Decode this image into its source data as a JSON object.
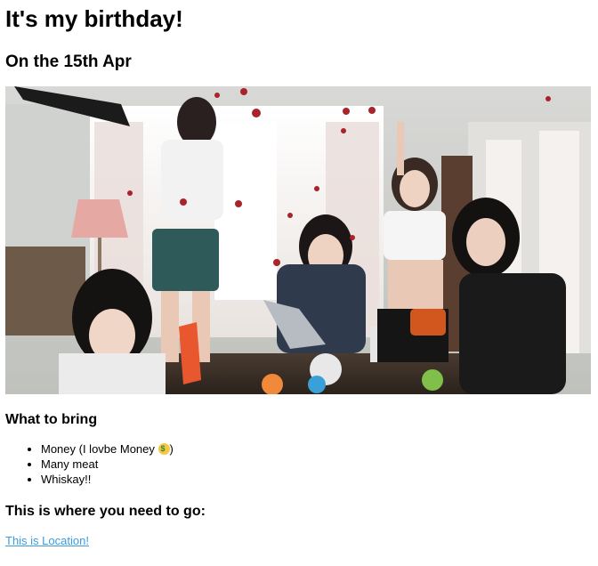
{
  "header": {
    "title": "It's my birthday!",
    "date": "On the 15th Apr"
  },
  "photo": {
    "description_icon": "group-photo"
  },
  "bring": {
    "heading": "What to bring",
    "items": [
      {
        "text_before": "Money (I lovbe Money ",
        "emoji": "money-face-emoji",
        "text_after": ")"
      },
      {
        "text": "Many meat"
      },
      {
        "text": "Whiskay!!"
      }
    ]
  },
  "location": {
    "heading": "This is where you need to go:",
    "link_text": "This is Location!"
  },
  "colors": {
    "link": "#3b9be0",
    "text": "#000000",
    "background": "#ffffff"
  }
}
